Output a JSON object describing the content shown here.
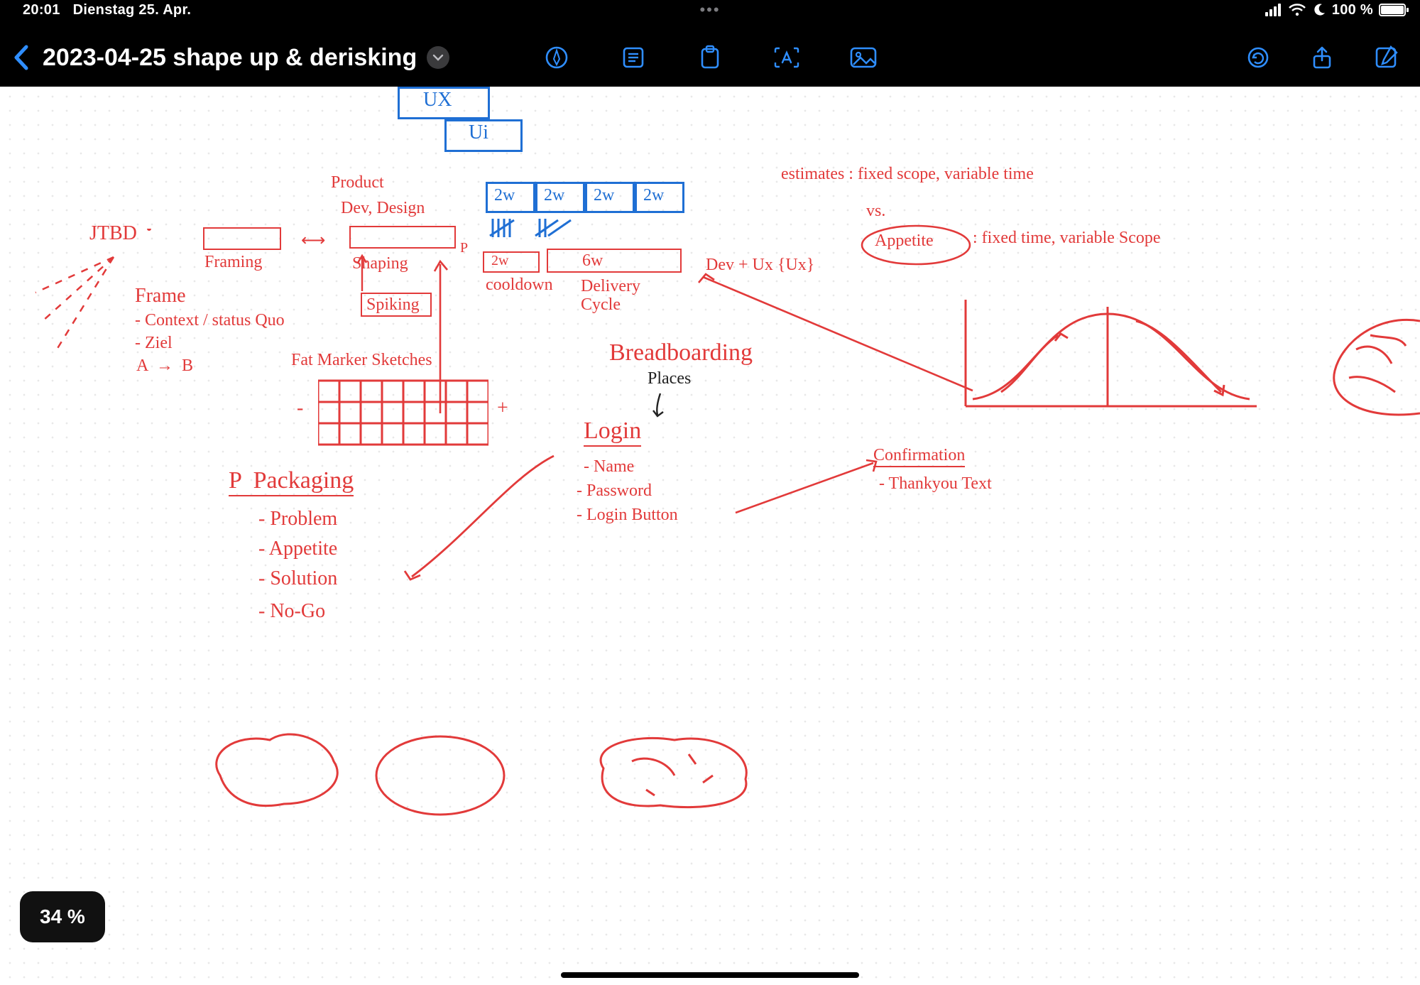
{
  "status": {
    "time": "20:01",
    "date": "Dienstag 25. Apr.",
    "battery_pct": "100 %"
  },
  "app": {
    "title": "2023-04-25 shape up & derisking"
  },
  "zoom": {
    "label": "34 %"
  },
  "notes": {
    "jtbd": "JTBD",
    "framing_label": "Framing",
    "frame": "Frame",
    "frame_l1": "- Context / status Quo",
    "frame_l2": "- Ziel",
    "frame_l3": "A  →  B",
    "product": "Product",
    "dev_design": "Dev, Design",
    "shaping": "Shaping",
    "spiking": "Spiking",
    "p_marker": "P",
    "fat_marker": "Fat Marker Sketches",
    "fat_minus": "-",
    "fat_plus": "+",
    "ux": "UX",
    "ui": "Ui",
    "twoW": "2w",
    "twoRow_label": "2w",
    "cooldown": "cooldown",
    "sixw": "6w",
    "delivery": "Delivery\nCycle",
    "dev_ux": "Dev + Ux {Ux}",
    "appetite": "Appetite",
    "estimates_1": "estimates : fixed scope, variable time",
    "vs": "vs.",
    "estimates_2": ": fixed time, variable Scope",
    "bread": "Breadboarding",
    "places": "Places",
    "login": "Login",
    "login_name": "- Name",
    "login_pw": "- Password",
    "login_btn": "- Login Button",
    "confirm": "Confirmation",
    "thank": "- Thankyou Text",
    "packaging": "P  Packaging",
    "pk_problem": "- Problem",
    "pk_appetite": "- Appetite",
    "pk_solution": "- Solution",
    "pk_nogo": "- No-Go"
  }
}
